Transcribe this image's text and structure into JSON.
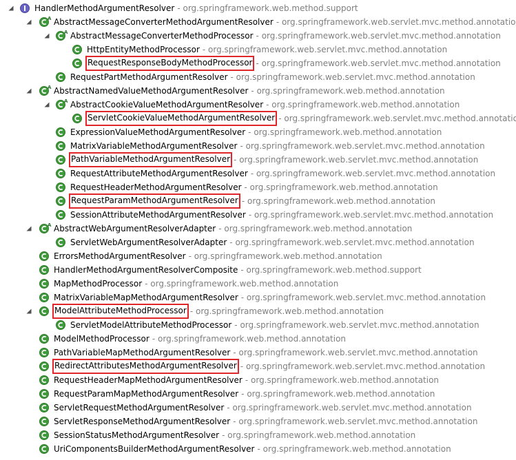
{
  "tree": [
    {
      "name": "HandlerMethodArgumentResolver",
      "pkg": "org.springframework.web.method.support",
      "level": 0,
      "kind": "interface",
      "expanded": true,
      "highlight": false
    },
    {
      "name": "AbstractMessageConverterMethodArgumentResolver",
      "pkg": "org.springframework.web.servlet.mvc.method.annotation",
      "level": 1,
      "kind": "abstract",
      "expanded": true,
      "highlight": false
    },
    {
      "name": "AbstractMessageConverterMethodProcessor",
      "pkg": "org.springframework.web.servlet.mvc.method.annotation",
      "level": 2,
      "kind": "abstract",
      "expanded": true,
      "highlight": false
    },
    {
      "name": "HttpEntityMethodProcessor",
      "pkg": "org.springframework.web.servlet.mvc.method.annotation",
      "level": 3,
      "kind": "class",
      "expanded": null,
      "highlight": false
    },
    {
      "name": "RequestResponseBodyMethodProcessor",
      "pkg": "org.springframework.web.servlet.mvc.method.annotation",
      "level": 3,
      "kind": "class",
      "expanded": null,
      "highlight": true
    },
    {
      "name": "RequestPartMethodArgumentResolver",
      "pkg": "org.springframework.web.servlet.mvc.method.annotation",
      "level": 2,
      "kind": "class",
      "expanded": null,
      "highlight": false
    },
    {
      "name": "AbstractNamedValueMethodArgumentResolver",
      "pkg": "org.springframework.web.method.annotation",
      "level": 1,
      "kind": "abstract",
      "expanded": true,
      "highlight": false
    },
    {
      "name": "AbstractCookieValueMethodArgumentResolver",
      "pkg": "org.springframework.web.method.annotation",
      "level": 2,
      "kind": "abstract",
      "expanded": true,
      "highlight": false
    },
    {
      "name": "ServletCookieValueMethodArgumentResolver",
      "pkg": "org.springframework.web.servlet.mvc.method.annotation",
      "level": 3,
      "kind": "class",
      "expanded": null,
      "highlight": true
    },
    {
      "name": "ExpressionValueMethodArgumentResolver",
      "pkg": "org.springframework.web.method.annotation",
      "level": 2,
      "kind": "class",
      "expanded": null,
      "highlight": false
    },
    {
      "name": "MatrixVariableMethodArgumentResolver",
      "pkg": "org.springframework.web.servlet.mvc.method.annotation",
      "level": 2,
      "kind": "class",
      "expanded": null,
      "highlight": false
    },
    {
      "name": "PathVariableMethodArgumentResolver",
      "pkg": "org.springframework.web.servlet.mvc.method.annotation",
      "level": 2,
      "kind": "class",
      "expanded": null,
      "highlight": true
    },
    {
      "name": "RequestAttributeMethodArgumentResolver",
      "pkg": "org.springframework.web.servlet.mvc.method.annotation",
      "level": 2,
      "kind": "class",
      "expanded": null,
      "highlight": false
    },
    {
      "name": "RequestHeaderMethodArgumentResolver",
      "pkg": "org.springframework.web.method.annotation",
      "level": 2,
      "kind": "class",
      "expanded": null,
      "highlight": false
    },
    {
      "name": "RequestParamMethodArgumentResolver",
      "pkg": "org.springframework.web.method.annotation",
      "level": 2,
      "kind": "class",
      "expanded": null,
      "highlight": true
    },
    {
      "name": "SessionAttributeMethodArgumentResolver",
      "pkg": "org.springframework.web.servlet.mvc.method.annotation",
      "level": 2,
      "kind": "class",
      "expanded": null,
      "highlight": false
    },
    {
      "name": "AbstractWebArgumentResolverAdapter",
      "pkg": "org.springframework.web.method.annotation",
      "level": 1,
      "kind": "abstract",
      "expanded": true,
      "highlight": false
    },
    {
      "name": "ServletWebArgumentResolverAdapter",
      "pkg": "org.springframework.web.servlet.mvc.method.annotation",
      "level": 2,
      "kind": "class",
      "expanded": null,
      "highlight": false
    },
    {
      "name": "ErrorsMethodArgumentResolver",
      "pkg": "org.springframework.web.method.annotation",
      "level": 1,
      "kind": "class",
      "expanded": null,
      "highlight": false
    },
    {
      "name": "HandlerMethodArgumentResolverComposite",
      "pkg": "org.springframework.web.method.support",
      "level": 1,
      "kind": "class",
      "expanded": null,
      "highlight": false
    },
    {
      "name": "MapMethodProcessor",
      "pkg": "org.springframework.web.method.annotation",
      "level": 1,
      "kind": "class",
      "expanded": null,
      "highlight": false
    },
    {
      "name": "MatrixVariableMapMethodArgumentResolver",
      "pkg": "org.springframework.web.servlet.mvc.method.annotation",
      "level": 1,
      "kind": "class",
      "expanded": null,
      "highlight": false
    },
    {
      "name": "ModelAttributeMethodProcessor",
      "pkg": "org.springframework.web.method.annotation",
      "level": 1,
      "kind": "class",
      "expanded": true,
      "highlight": true
    },
    {
      "name": "ServletModelAttributeMethodProcessor",
      "pkg": "org.springframework.web.servlet.mvc.method.annotation",
      "level": 2,
      "kind": "class",
      "expanded": null,
      "highlight": false
    },
    {
      "name": "ModelMethodProcessor",
      "pkg": "org.springframework.web.method.annotation",
      "level": 1,
      "kind": "class",
      "expanded": null,
      "highlight": false
    },
    {
      "name": "PathVariableMapMethodArgumentResolver",
      "pkg": "org.springframework.web.servlet.mvc.method.annotation",
      "level": 1,
      "kind": "class",
      "expanded": null,
      "highlight": false
    },
    {
      "name": "RedirectAttributesMethodArgumentResolver",
      "pkg": "org.springframework.web.servlet.mvc.method.annotation",
      "level": 1,
      "kind": "class",
      "expanded": null,
      "highlight": true
    },
    {
      "name": "RequestHeaderMapMethodArgumentResolver",
      "pkg": "org.springframework.web.method.annotation",
      "level": 1,
      "kind": "class",
      "expanded": null,
      "highlight": false
    },
    {
      "name": "RequestParamMapMethodArgumentResolver",
      "pkg": "org.springframework.web.method.annotation",
      "level": 1,
      "kind": "class",
      "expanded": null,
      "highlight": false
    },
    {
      "name": "ServletRequestMethodArgumentResolver",
      "pkg": "org.springframework.web.servlet.mvc.method.annotation",
      "level": 1,
      "kind": "class",
      "expanded": null,
      "highlight": false
    },
    {
      "name": "ServletResponseMethodArgumentResolver",
      "pkg": "org.springframework.web.servlet.mvc.method.annotation",
      "level": 1,
      "kind": "class",
      "expanded": null,
      "highlight": false
    },
    {
      "name": "SessionStatusMethodArgumentResolver",
      "pkg": "org.springframework.web.method.annotation",
      "level": 1,
      "kind": "class",
      "expanded": null,
      "highlight": false
    },
    {
      "name": "UriComponentsBuilderMethodArgumentResolver",
      "pkg": "org.springframework.web.method.annotation",
      "level": 1,
      "kind": "class",
      "expanded": null,
      "highlight": false
    }
  ],
  "separator": "-",
  "colors": {
    "class_icon": "#3f9a3b",
    "interface_icon": "#6a63c8",
    "highlight_border": "#e0262b",
    "package_text": "#7f7f7f"
  },
  "icons": {
    "class": "class-c-icon",
    "abstract": "abstract-class-icon",
    "interface": "interface-i-icon",
    "expanded": "tree-expanded-arrow-icon"
  }
}
